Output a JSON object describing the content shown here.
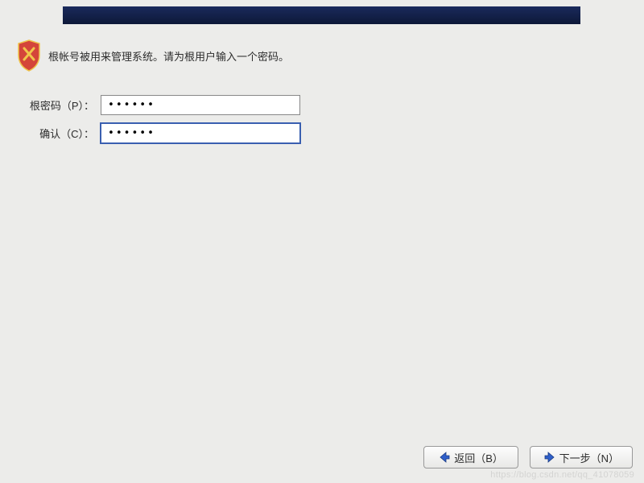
{
  "instruction": "根帐号被用来管理系统。请为根用户输入一个密码。",
  "form": {
    "password_label": "根密码（P）：",
    "password_value": "••••••",
    "confirm_label": "确认（C）：",
    "confirm_value": "••••••"
  },
  "buttons": {
    "back": "返回（B）",
    "next": "下一步（N）"
  },
  "watermark": "https://blog.csdn.net/qq_41078059"
}
